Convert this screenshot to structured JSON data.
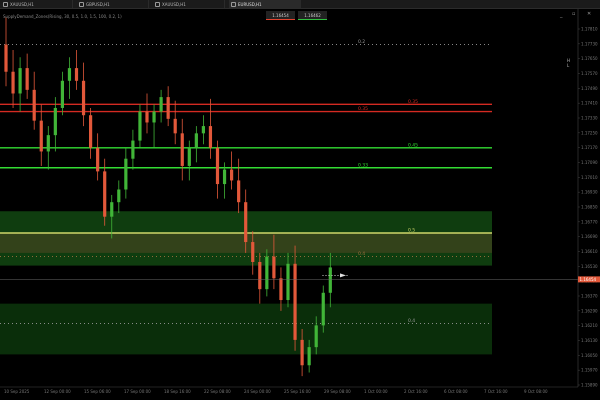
{
  "tabs": [
    {
      "label": "XAUUSD,H1",
      "active": false
    },
    {
      "label": "GBPUSD,H1",
      "active": false
    },
    {
      "label": "XAUUSD,H1",
      "active": false
    },
    {
      "label": "EURUSD,H1",
      "active": true
    }
  ],
  "indicator_info": "SupplyDemand_Zones(Rising, 30, 0.5, 1.0, 1.5, 100, 0.2, 1)",
  "trade_panel": {
    "sell_label": "1.16454",
    "buy_label": "1.16462"
  },
  "window_controls": {
    "minimize_icon": "minimize-icon",
    "restore_icon": "restore-icon",
    "close_icon": "close-icon"
  },
  "hl_label": "H\nL",
  "colors": {
    "bull": "#41b538",
    "bear": "#e2583a",
    "red_line": "#d42a22",
    "green_line": "#33dd33",
    "zone_green": "#0f3d0f",
    "zone_olive": "#2a3514"
  },
  "price_axis": {
    "ticks": [
      "1.17810",
      "1.17730",
      "1.17650",
      "1.17570",
      "1.17490",
      "1.17410",
      "1.17330",
      "1.17250",
      "1.17170",
      "1.17090",
      "1.17010",
      "1.16930",
      "1.16850",
      "1.16770",
      "1.16690",
      "1.16610",
      "1.16530",
      "1.16450",
      "1.16370",
      "1.16290",
      "1.16210",
      "1.16130",
      "1.16050",
      "1.15970",
      "1.15890"
    ],
    "current_price": "1.16454"
  },
  "time_axis": {
    "ticks": [
      "10 Sep 2025",
      "12 Sep 00:00",
      "15 Sep 06:00",
      "17 Sep 00:00",
      "18 Sep 16:00",
      "22 Sep 08:00",
      "24 Sep 00:00",
      "25 Sep 16:00",
      "29 Sep 08:00",
      "1 Oct 00:00",
      "2 Oct 16:00",
      "6 Oct 08:00",
      "7 Oct 16:00",
      "9 Oct 08:00"
    ]
  },
  "levels": [
    {
      "label": "0.2",
      "price": 1.1775,
      "style": "dotted",
      "color": "#9a9a9a"
    },
    {
      "label": "0.35",
      "price": 1.1742,
      "style": "solid",
      "color": "#d42a22"
    },
    {
      "label": "0.35",
      "price": 1.1738,
      "style": "solid",
      "color": "#d42a22"
    },
    {
      "label": "0.45",
      "price": 1.1718,
      "style": "solid",
      "color": "#33dd33"
    },
    {
      "label": "0.33",
      "price": 1.1707,
      "style": "solid",
      "color": "#33dd33"
    },
    {
      "label": "0.5",
      "price": 1.1671,
      "style": "solid",
      "color": "#cfd66a"
    },
    {
      "label": "0.4",
      "price": 1.1658,
      "style": "dotted",
      "color": "#a07040"
    },
    {
      "label": "0.4",
      "price": 1.1621,
      "style": "dotted",
      "color": "#9a9a9a"
    }
  ],
  "zones": [
    {
      "name": "demand-zone-upper",
      "top": 1.1683,
      "bottom": 1.1653,
      "color": "#0f3d0f"
    },
    {
      "name": "demand-zone-olive",
      "top": 1.1671,
      "bottom": 1.166,
      "color": "#33421a"
    },
    {
      "name": "demand-zone-lower",
      "top": 1.1632,
      "bottom": 1.1604,
      "color": "#0a2e0a"
    }
  ],
  "chart_data": {
    "type": "candlestick",
    "y_range": [
      1.1586,
      1.1788
    ],
    "candles": [
      [
        1.1775,
        1.179,
        1.1752,
        1.176
      ],
      [
        1.176,
        1.1772,
        1.174,
        1.1748
      ],
      [
        1.1748,
        1.1768,
        1.1738,
        1.1762
      ],
      [
        1.1762,
        1.177,
        1.1745,
        1.175
      ],
      [
        1.175,
        1.176,
        1.1728,
        1.1733
      ],
      [
        1.1733,
        1.1742,
        1.1708,
        1.1716
      ],
      [
        1.1716,
        1.173,
        1.1706,
        1.1725
      ],
      [
        1.1725,
        1.1746,
        1.1716,
        1.174
      ],
      [
        1.174,
        1.176,
        1.1736,
        1.1755
      ],
      [
        1.1755,
        1.1768,
        1.1745,
        1.1762
      ],
      [
        1.1762,
        1.1772,
        1.175,
        1.1755
      ],
      [
        1.1755,
        1.1765,
        1.173,
        1.1736
      ],
      [
        1.1736,
        1.174,
        1.1712,
        1.1718
      ],
      [
        1.1718,
        1.1726,
        1.17,
        1.1705
      ],
      [
        1.1705,
        1.1712,
        1.1675,
        1.168
      ],
      [
        1.168,
        1.1692,
        1.1668,
        1.1688
      ],
      [
        1.1688,
        1.17,
        1.1682,
        1.1695
      ],
      [
        1.1695,
        1.1718,
        1.169,
        1.1712
      ],
      [
        1.1712,
        1.1728,
        1.1706,
        1.1722
      ],
      [
        1.1722,
        1.1742,
        1.1718,
        1.1738
      ],
      [
        1.1738,
        1.1748,
        1.1726,
        1.1732
      ],
      [
        1.1732,
        1.1742,
        1.1718,
        1.1738
      ],
      [
        1.1738,
        1.175,
        1.1732,
        1.1746
      ],
      [
        1.1746,
        1.1752,
        1.173,
        1.1734
      ],
      [
        1.1734,
        1.1744,
        1.172,
        1.1726
      ],
      [
        1.1726,
        1.1734,
        1.17,
        1.1708
      ],
      [
        1.1708,
        1.1722,
        1.17,
        1.1718
      ],
      [
        1.1718,
        1.173,
        1.171,
        1.1726
      ],
      [
        1.1726,
        1.1736,
        1.172,
        1.173
      ],
      [
        1.173,
        1.1745,
        1.1712,
        1.1718
      ],
      [
        1.1718,
        1.1722,
        1.169,
        1.1698
      ],
      [
        1.1698,
        1.171,
        1.169,
        1.1706
      ],
      [
        1.1706,
        1.1716,
        1.1695,
        1.17
      ],
      [
        1.17,
        1.1712,
        1.1682,
        1.1688
      ],
      [
        1.1688,
        1.1695,
        1.166,
        1.1666
      ],
      [
        1.1666,
        1.1672,
        1.1648,
        1.1655
      ],
      [
        1.1655,
        1.166,
        1.1632,
        1.164
      ],
      [
        1.164,
        1.1662,
        1.1636,
        1.1658
      ],
      [
        1.1658,
        1.167,
        1.164,
        1.1646
      ],
      [
        1.1646,
        1.1652,
        1.1628,
        1.1634
      ],
      [
        1.1634,
        1.166,
        1.163,
        1.1654
      ],
      [
        1.1654,
        1.1664,
        1.1606,
        1.1612
      ],
      [
        1.1612,
        1.1618,
        1.1592,
        1.1598
      ],
      [
        1.1598,
        1.1612,
        1.1594,
        1.1608
      ],
      [
        1.1608,
        1.1625,
        1.1604,
        1.162
      ],
      [
        1.162,
        1.1642,
        1.1616,
        1.1638
      ],
      [
        1.1638,
        1.166,
        1.163,
        1.1652
      ]
    ]
  }
}
